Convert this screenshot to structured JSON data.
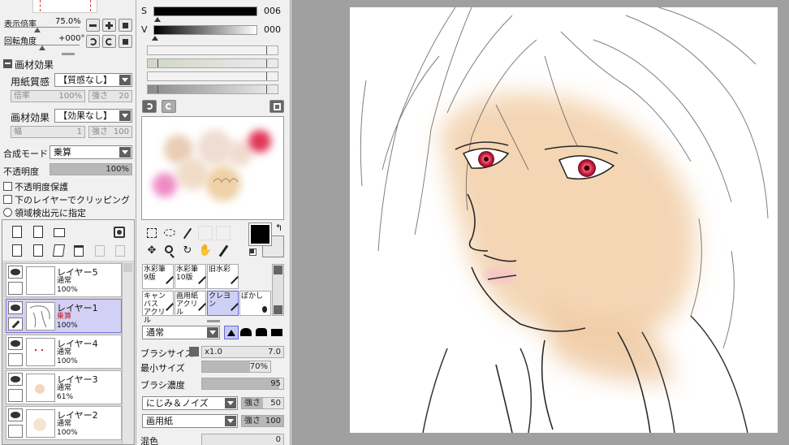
{
  "nav": {
    "zoom_label": "表示倍率",
    "zoom_value": "75.0%",
    "rotation_label": "回転角度",
    "rotation_value": "+000°"
  },
  "texture": {
    "section_title": "画材効果",
    "paper_label": "用紙質感",
    "paper_value": "【質感なし】",
    "scale_label": "倍率",
    "scale_value": "100%",
    "strength_label": "強さ",
    "strength_value": "20",
    "effect_label": "画材効果",
    "effect_value": "【効果なし】",
    "width_label": "幅",
    "width_value": "1",
    "effect_strength_label": "強さ",
    "effect_strength_value": "100"
  },
  "layer_props": {
    "blend_label": "合成モード",
    "blend_value": "乗算",
    "opacity_label": "不透明度",
    "opacity_value": "100%",
    "opacity_fraction": 1.0,
    "protect_label": "不透明度保護",
    "clip_label": "下のレイヤーでクリッピング",
    "select_source_label": "領域検出元に指定"
  },
  "layers": [
    {
      "name": "レイヤー5",
      "mode": "通常",
      "opacity": "100%"
    },
    {
      "name": "レイヤー1",
      "mode": "乗算",
      "opacity": "100%",
      "selected": true
    },
    {
      "name": "レイヤー4",
      "mode": "通常",
      "opacity": "100%"
    },
    {
      "name": "レイヤー3",
      "mode": "通常",
      "opacity": "61%"
    },
    {
      "name": "レイヤー2",
      "mode": "通常",
      "opacity": "100%"
    }
  ],
  "color": {
    "s_label": "S",
    "s_value": "006",
    "v_label": "V",
    "v_value": "000",
    "primary": "#000000",
    "secondary": "#ffffff"
  },
  "tools": [
    "rect-select-icon",
    "lasso-icon",
    "magic-wand-icon",
    "move-icon",
    "zoom-icon",
    "rotate-icon",
    "hand-icon",
    "eyedropper-icon"
  ],
  "brushes": [
    {
      "label": "水彩筆",
      "sub": "9版"
    },
    {
      "label": "水彩筆",
      "sub": "10版"
    },
    {
      "label": "旧水彩",
      "sub": ""
    },
    {
      "label": "キャンバス",
      "sub": "アクリル"
    },
    {
      "label": "画用紙",
      "sub": "アクリル"
    },
    {
      "label": "クレヨン",
      "sub": "",
      "selected": true
    },
    {
      "label": "ぼかし",
      "sub": ""
    }
  ],
  "brush_settings": {
    "mode_value": "通常",
    "size_label": "ブラシサイズ",
    "size_multiplier": "x1.0",
    "size_value": "7.0",
    "min_size_label": "最小サイズ",
    "min_size_value": "70%",
    "min_size_fraction": 0.7,
    "density_label": "ブラシ濃度",
    "density_value": "95",
    "density_fraction": 0.95,
    "noise_value": "にじみ＆ノイズ",
    "noise_strength_label": "強さ",
    "noise_strength_value": "50",
    "paper_value": "画用紙",
    "paper_strength_label": "強さ",
    "paper_strength_value": "100",
    "blend_label": "混色",
    "blend_value": "0"
  }
}
